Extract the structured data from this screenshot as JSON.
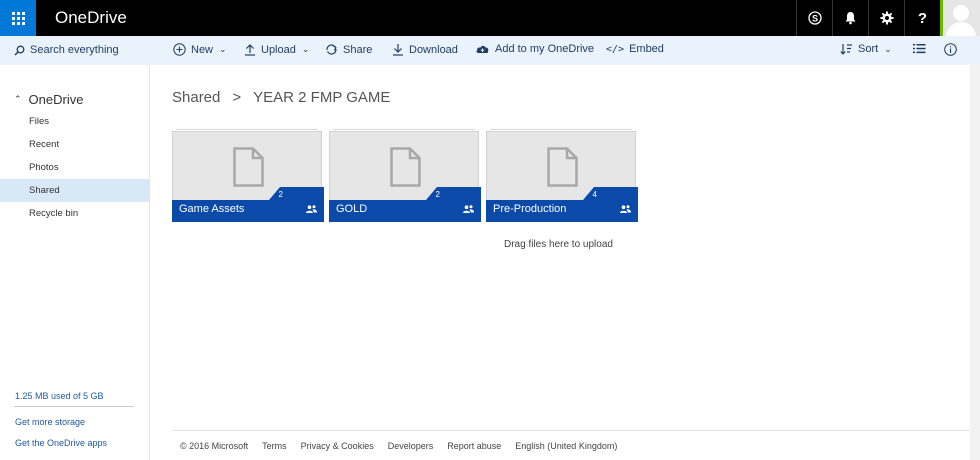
{
  "header": {
    "app_name": "OneDrive",
    "icons": [
      "skype-icon",
      "bell-icon",
      "gear-icon",
      "help-icon"
    ]
  },
  "commandbar": {
    "search_placeholder": "Search everything",
    "new": "New",
    "upload": "Upload",
    "share": "Share",
    "download": "Download",
    "add": "Add to my OneDrive",
    "embed": "Embed",
    "sort": "Sort"
  },
  "nav": {
    "root": "OneDrive",
    "items": [
      {
        "label": "Files"
      },
      {
        "label": "Recent"
      },
      {
        "label": "Photos"
      },
      {
        "label": "Shared"
      },
      {
        "label": "Recycle bin"
      }
    ],
    "active_index": 3,
    "storage": "1.25 MB used of 5 GB",
    "get_storage": "Get more storage",
    "get_apps": "Get the OneDrive apps"
  },
  "breadcrumb": {
    "parent": "Shared",
    "separator": ">",
    "current": "YEAR 2 FMP GAME"
  },
  "folders": [
    {
      "name": "Game Assets",
      "count": "2"
    },
    {
      "name": "GOLD",
      "count": "2"
    },
    {
      "name": "Pre-Production",
      "count": "4"
    }
  ],
  "drag_hint": "Drag files here to upload",
  "footer": {
    "copyright": "© 2016 Microsoft",
    "links": [
      "Terms",
      "Privacy & Cookies",
      "Developers",
      "Report abuse",
      "English (United Kingdom)"
    ]
  },
  "colors": {
    "accent": "#0078d7",
    "topbar": "#000000",
    "commandbar": "#eaf2fb",
    "tile_band": "#0b4aa8",
    "active_nav": "#d9e8f7",
    "link": "#1e5aa3"
  }
}
